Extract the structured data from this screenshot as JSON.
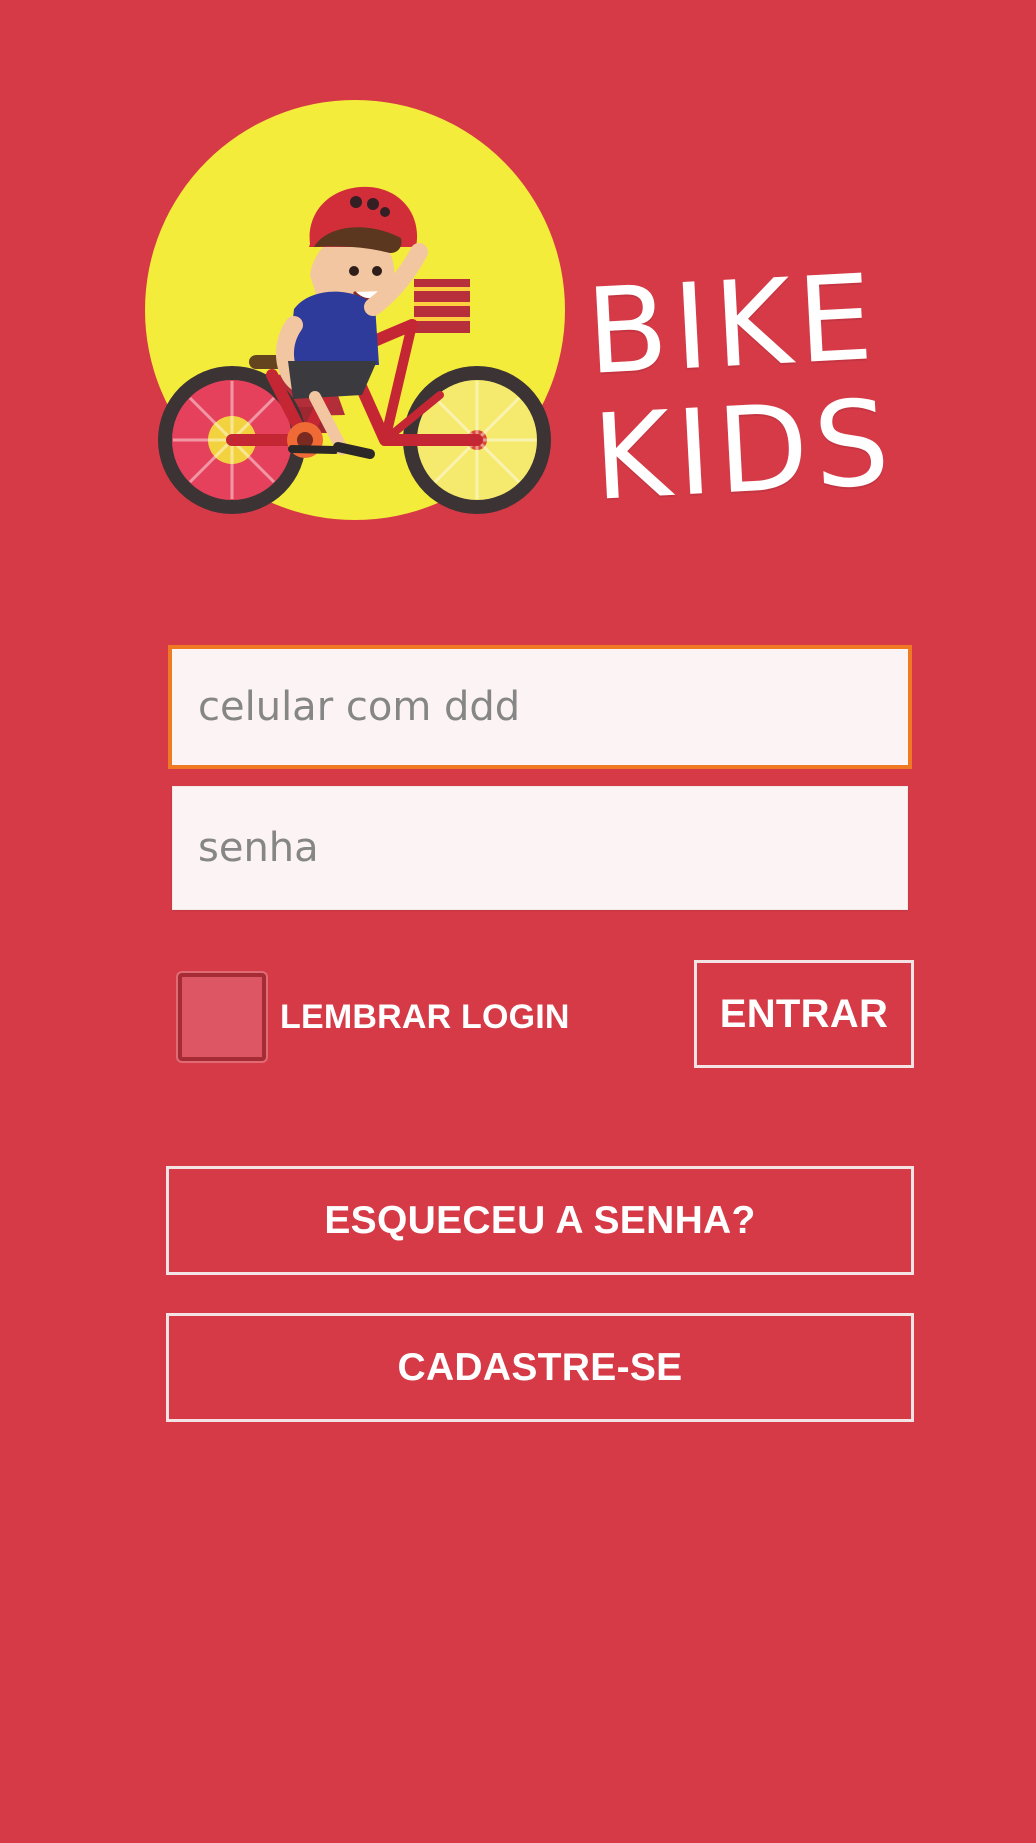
{
  "app": {
    "brand_line_1": "BIKE",
    "brand_line_2": "KIDS"
  },
  "form": {
    "phone_placeholder": "celular com ddd",
    "password_placeholder": "senha",
    "remember_label": "LEMBRAR LOGIN",
    "submit_label": "ENTRAR"
  },
  "actions": {
    "forgot_label": "ESQUECEU A SENHA?",
    "signup_label": "CADASTRE-SE"
  },
  "colors": {
    "background": "#d63a47",
    "field_background": "#fbf3f4",
    "focused_border": "#f07a24",
    "button_border": "#f3e3e5",
    "logo_circle": "#f4ec3b"
  },
  "icons": {
    "logo": "bike-kid-logo-icon"
  }
}
